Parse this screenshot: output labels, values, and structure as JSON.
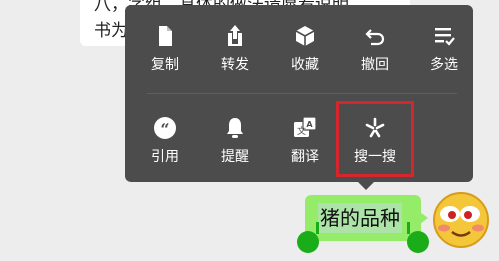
{
  "chat": {
    "left_bubble_line1": "八，字组，具体的做法请愿看说明",
    "left_bubble_line2": "书为"
  },
  "menu": {
    "row1": [
      {
        "label": "复制",
        "icon": "copy-icon"
      },
      {
        "label": "转发",
        "icon": "forward-icon"
      },
      {
        "label": "收藏",
        "icon": "favorite-icon"
      },
      {
        "label": "撤回",
        "icon": "recall-icon"
      },
      {
        "label": "多选",
        "icon": "multi-select-icon"
      }
    ],
    "row2": [
      {
        "label": "引用",
        "icon": "quote-icon"
      },
      {
        "label": "提醒",
        "icon": "bell-icon"
      },
      {
        "label": "翻译",
        "icon": "translate-icon"
      },
      {
        "label": "搜一搜",
        "icon": "search-sparkle-icon"
      }
    ],
    "translate_icon_glyph_zh": "文",
    "translate_icon_glyph_en": "A"
  },
  "message": {
    "text": "猪的品种",
    "bubble_color": "#95ec69",
    "selection_color": "#ace3a6"
  },
  "colors": {
    "menu_bg": "#4c4c4c",
    "highlight": "#d6252d",
    "handle": "#1aad19"
  }
}
